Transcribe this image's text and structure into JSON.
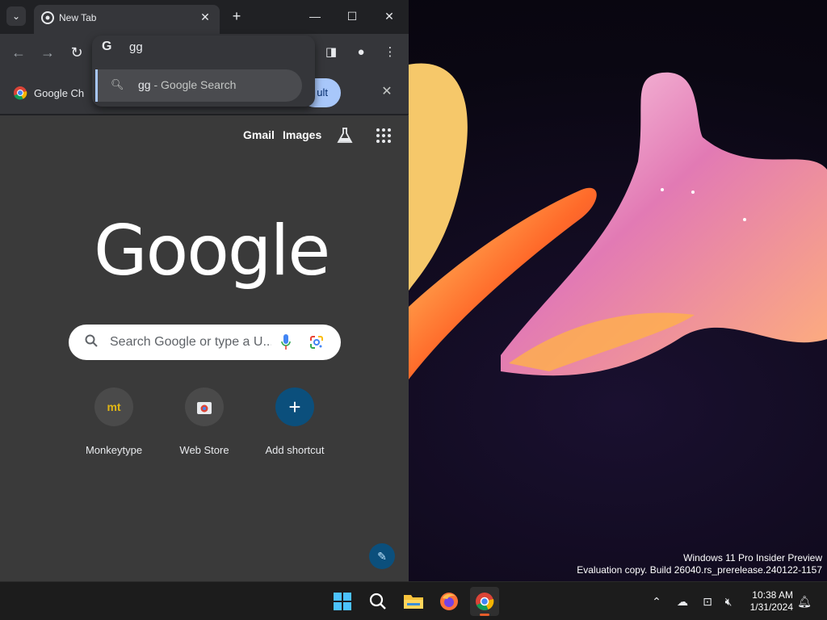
{
  "desktop": {
    "watermark_line1": "Windows 11 Pro Insider Preview",
    "watermark_line2": "Evaluation copy. Build 26040.rs_prerelease.240122-1157"
  },
  "browser": {
    "tab_title": "New Tab",
    "omnibox_value": "gg",
    "suggestion_query": "gg",
    "suggestion_sub": " - Google Search",
    "bookmark_label": "Google Ch",
    "default_button_label": "ult"
  },
  "ntp": {
    "links": {
      "gmail": "Gmail",
      "images": "Images"
    },
    "logo": "Google",
    "search_placeholder": "Search Google or type a U...",
    "shortcuts": [
      {
        "label": "Monkeytype",
        "icon": "monkeytype-icon"
      },
      {
        "label": "Web Store",
        "icon": "web-store-icon"
      },
      {
        "label": "Add shortcut",
        "icon": "plus-icon"
      }
    ]
  },
  "taskbar": {
    "apps": [
      "start-icon",
      "search-icon",
      "file-explorer-icon",
      "firefox-icon",
      "chrome-icon"
    ],
    "time": "10:38 AM",
    "date": "1/31/2024"
  },
  "colors": {
    "accent_blue": "#a8c7fa",
    "ntp_background": "#3a3a3a",
    "toolbar": "#35363a"
  }
}
